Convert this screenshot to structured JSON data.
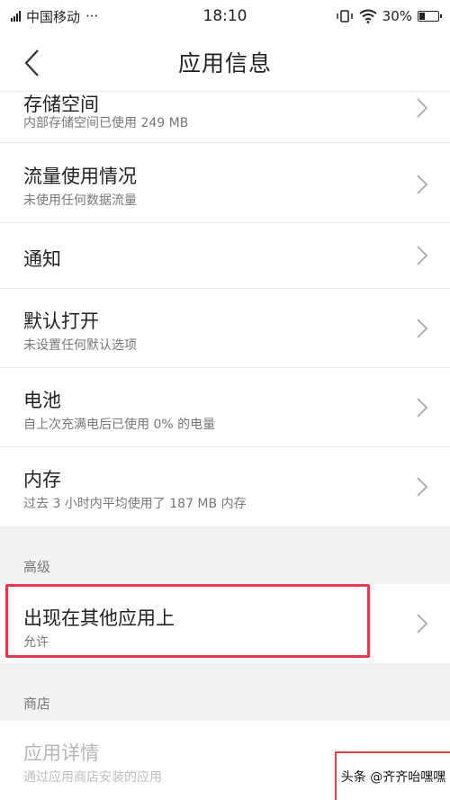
{
  "status_bar": {
    "carrier": "中国移动",
    "more": "···",
    "time": "18:10",
    "battery_percent": "30%",
    "battery_level": 0.3
  },
  "app_bar": {
    "title": "应用信息",
    "back_icon": "chevron-left-icon"
  },
  "rows": [
    {
      "title": "存储空间",
      "subtitle": "内部存储空间已使用 249 MB"
    },
    {
      "title": "流量使用情况",
      "subtitle": "未使用任何数据流量"
    },
    {
      "title": "通知",
      "subtitle": ""
    },
    {
      "title": "默认打开",
      "subtitle": "未设置任何默认选项"
    },
    {
      "title": "电池",
      "subtitle": "自上次充满电后已使用 0% 的电量"
    },
    {
      "title": "内存",
      "subtitle": "过去 3 小时内平均使用了 187 MB 内存"
    }
  ],
  "advanced": {
    "header": "高级",
    "item": {
      "title": "出现在其他应用上",
      "subtitle": "允许"
    }
  },
  "store": {
    "header": "商店",
    "item": {
      "title": "应用详情",
      "subtitle": "通过应用商店安装的应用"
    }
  },
  "watermark": "头条 @齐齐咍嘿嘿",
  "colors": {
    "highlight": "#e43a4f",
    "section_bg": "#f2f2f2"
  }
}
